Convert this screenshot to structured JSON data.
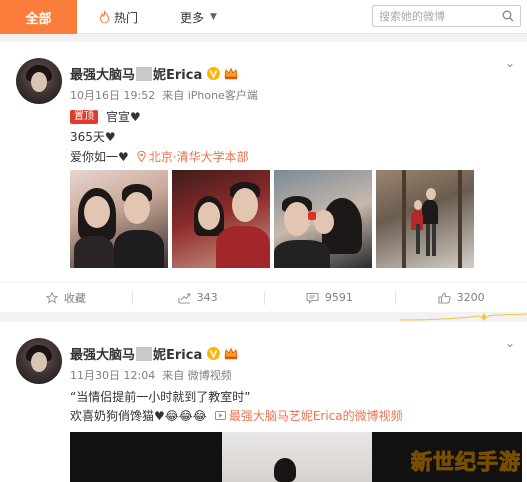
{
  "nav": {
    "tab_all": "全部",
    "tab_hot": "热门",
    "tab_more": "更多",
    "search_placeholder": "搜索她的微博"
  },
  "posts": [
    {
      "author_pre": "最强大脑马",
      "author_post": "妮Erica",
      "date": "10月16日 19:52",
      "source": "来自 iPhone客户端",
      "pin_label": "置顶",
      "line1": "官宣♥",
      "line2": "365天♥",
      "line3": "爱你如一♥",
      "location": "北京·清华大学本部",
      "actions": {
        "collect": "收藏",
        "repost": "343",
        "comment": "9591",
        "like": "3200"
      }
    },
    {
      "author_pre": "最强大脑马",
      "author_post": "妮Erica",
      "date": "11月30日 12:04",
      "source": "来自 微博视频",
      "line1": "“当情侣提前一小时就到了教室时”",
      "line2": "欢喜奶狗俏馋猫♥😂😂😂",
      "video_link": "最强大脑马艺妮Erica的微博视频"
    }
  ],
  "watermark": "新世纪手游",
  "colors": {
    "accent": "#fa7d3c",
    "link": "#eb7350",
    "pin": "#e03c2c"
  }
}
